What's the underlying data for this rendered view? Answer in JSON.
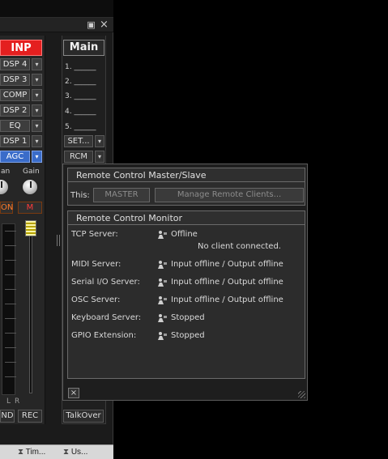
{
  "input_strip": {
    "label": "INP",
    "processing": [
      "DSP 4",
      "DSP 3",
      "COMP",
      "DSP 2",
      "EQ",
      "DSP 1",
      "AGC"
    ],
    "active": "AGC",
    "knob_labels": [
      "an",
      "Gain"
    ],
    "mode_buttons": [
      "ON",
      "M"
    ],
    "lr_labels": [
      "L",
      "R"
    ],
    "bottom_buttons": [
      "ND",
      "REC"
    ]
  },
  "main_strip": {
    "label": "Main",
    "slots": [
      "1. ______",
      "2. ______",
      "3. ______",
      "4. ______",
      "5. ______"
    ],
    "selectors": [
      "SET...",
      "RCM"
    ],
    "talkover_label": "TalkOver"
  },
  "status_bar": {
    "items": [
      "Tim...",
      "Us..."
    ]
  },
  "remote_control": {
    "master_group": {
      "title": "Remote Control Master/Slave",
      "this_label": "This:",
      "master_button": "MASTER",
      "manage_button": "Manage Remote Clients..."
    },
    "monitor_group": {
      "title": "Remote Control Monitor",
      "rows": [
        {
          "label": "TCP Server:",
          "value": "Offline",
          "detail": "No client connected."
        },
        {
          "label": "MIDI Server:",
          "value": "Input offline / Output offline"
        },
        {
          "label": "Serial I/O Server:",
          "value": "Input offline / Output offline"
        },
        {
          "label": "OSC Server:",
          "value": "Input offline / Output offline"
        },
        {
          "label": "Keyboard Server:",
          "value": "Stopped"
        },
        {
          "label": "GPIO Extension:",
          "value": "Stopped"
        }
      ]
    },
    "close_glyph": "×"
  },
  "window_controls": {
    "restore": "▣",
    "close": "×"
  }
}
